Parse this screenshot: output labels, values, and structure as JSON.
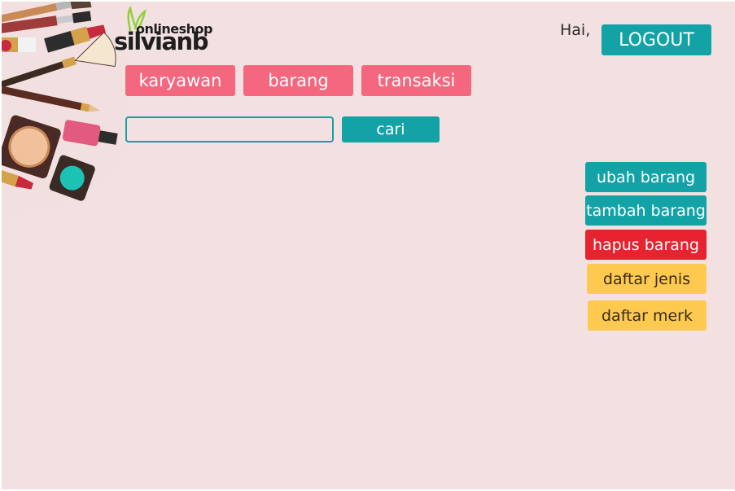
{
  "header": {
    "logo_small": "onlineshop",
    "logo_name": "silvianb",
    "greeting": "Hai,",
    "logout_label": "LOGOUT"
  },
  "nav": {
    "items": [
      {
        "label": "karyawan"
      },
      {
        "label": "barang"
      },
      {
        "label": "transaksi"
      }
    ]
  },
  "search": {
    "value": "",
    "placeholder": "",
    "button_label": "cari"
  },
  "actions": {
    "ubah": "ubah barang",
    "tambah": "tambah barang",
    "hapus": "hapus barang",
    "jenis": "daftar jenis",
    "merk": "daftar merk"
  },
  "colors": {
    "background": "#f3e0e1",
    "teal": "#13a3a7",
    "pink": "#f4677f",
    "red": "#e6232f",
    "yellow": "#fdc94f",
    "logo_green": "#8fd13b"
  },
  "icons": [
    "makeup-decoration",
    "leaf-logo-icon"
  ]
}
